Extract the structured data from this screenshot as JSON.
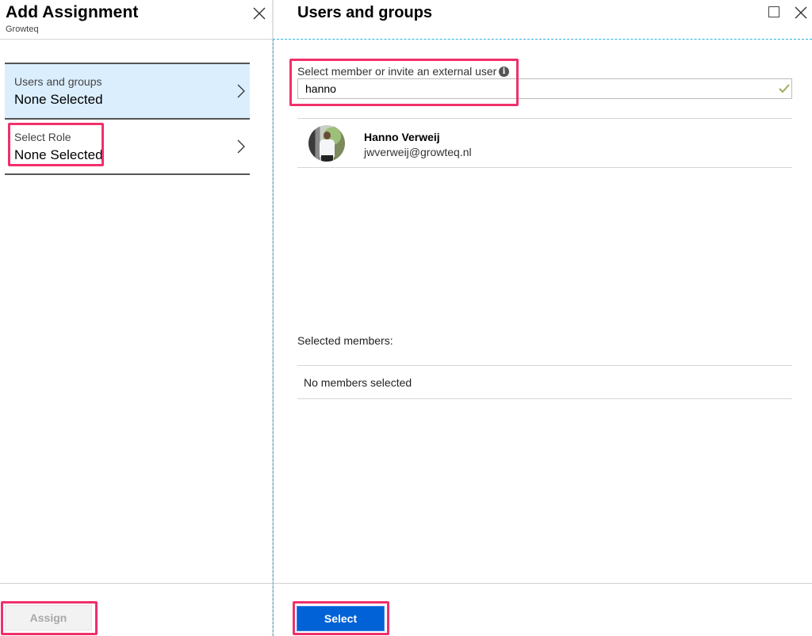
{
  "left_blade": {
    "title": "Add Assignment",
    "subtitle": "Growteq",
    "close_icon": "close-icon",
    "items": [
      {
        "label": "Users and groups",
        "value": "None Selected",
        "active": true,
        "highlighted": false
      },
      {
        "label": "Select Role",
        "value": "None Selected",
        "active": false,
        "highlighted": true
      }
    ],
    "assign_button": {
      "label": "Assign",
      "enabled": false,
      "highlighted": true
    }
  },
  "right_blade": {
    "title": "Users and groups",
    "maximize_icon": "maximize-icon",
    "close_icon": "close-icon",
    "search": {
      "label": "Select member or invite an external user",
      "info_icon": "info-icon",
      "value": "hanno",
      "placeholder": "",
      "valid_icon": "checkmark-icon",
      "highlighted": true
    },
    "results": [
      {
        "name": "Hanno Verweij",
        "email": "jwverweij@growteq.nl",
        "avatar": "user-photo"
      }
    ],
    "selected_members_label": "Selected members:",
    "no_members_text": "No members selected",
    "select_button": {
      "label": "Select",
      "enabled": true,
      "highlighted": true
    }
  },
  "colors": {
    "highlight": "#f0306a",
    "active_item_bg": "#dbeefd",
    "primary_button": "#0062d6",
    "focus_dash": "#2bb3e0",
    "valid_check": "#9aad5c"
  }
}
